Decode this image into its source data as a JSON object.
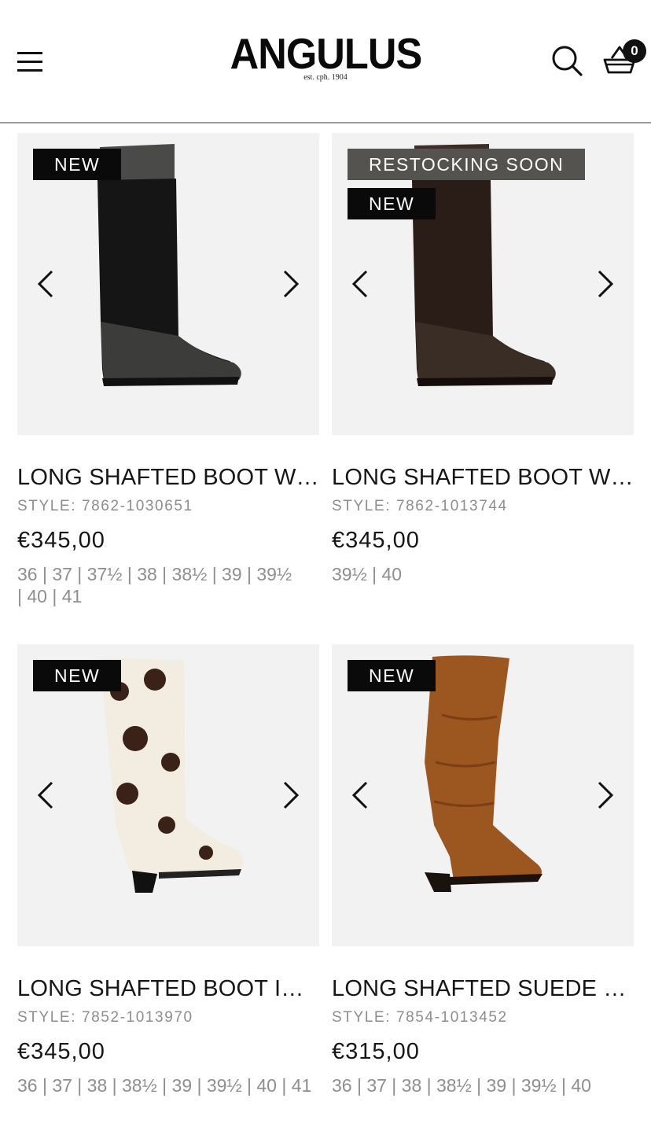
{
  "header": {
    "brand": "ANGULUS",
    "tagline": "est. cph. 1904",
    "cart_count": "0"
  },
  "products": [
    {
      "badges": [
        "NEW"
      ],
      "title": "LONG SHAFTED BOOT WI...",
      "style": "STYLE: 7862-1030651",
      "price": "€345,00",
      "sizes": "36 | 37 | 37½ | 38 | 38½ | 39 | 39½ | 40 | 41",
      "color": "#1c1c1c"
    },
    {
      "badges": [
        "RESTOCKING SOON",
        "NEW"
      ],
      "title": "LONG SHAFTED BOOT WI...",
      "style": "STYLE: 7862-1013744",
      "price": "€345,00",
      "sizes": "39½ | 40",
      "color": "#3a2a22"
    },
    {
      "badges": [
        "NEW"
      ],
      "title": "LONG SHAFTED BOOT IN ...",
      "style": "STYLE: 7852-1013970",
      "price": "€345,00",
      "sizes": "36 | 37 | 38 | 38½ | 39 | 39½ | 40 | 41",
      "color": "#f3ece0"
    },
    {
      "badges": [
        "NEW"
      ],
      "title": "LONG SHAFTED SUEDE B...",
      "style": "STYLE: 7854-1013452",
      "price": "€315,00",
      "sizes": "36 | 37 | 38 | 38½ | 39 | 39½ | 40",
      "color": "#9c5620"
    }
  ]
}
